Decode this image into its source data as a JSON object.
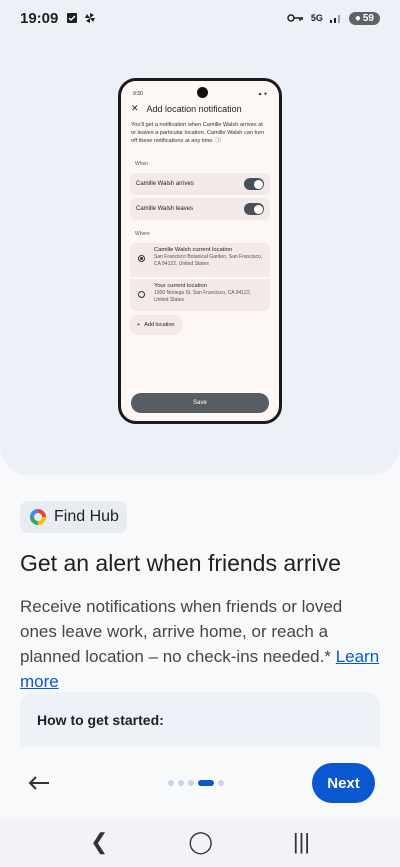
{
  "status_bar": {
    "time": "19:09",
    "network": "5G",
    "battery": "59"
  },
  "mockup": {
    "status_time": "9:30",
    "header_title": "Add location notification",
    "intro": "You'll get a notification when Camille Walsh arrives at or leaves a particular location. Camille Walsh can turn off these notifications at any time.",
    "when_label": "When",
    "toggles": [
      {
        "label": "Camille Walsh arrives",
        "on": true
      },
      {
        "label": "Camille Walsh leaves",
        "on": true
      }
    ],
    "where_label": "Where",
    "locations": [
      {
        "title": "Camille Walsh current location",
        "address": "San Francisco Botanical Garden, San Francisco, CA 94122, United States",
        "selected": true
      },
      {
        "title": "Your current location",
        "address": "1300 Noriega St, San Francisco, CA 94122, United States",
        "selected": false
      }
    ],
    "add_location": "Add location",
    "save": "Save"
  },
  "chip": {
    "label": "Find Hub"
  },
  "title": "Get an alert when friends arrive",
  "description": "Receive notifications when friends or loved ones leave work, arrive home, or reach a planned location – no check-ins needed.*",
  "learn_more": "Learn more",
  "how_to": "How to get started:",
  "pager": {
    "total": 5,
    "current": 4
  },
  "next_label": "Next",
  "colors": {
    "accent": "#0b57d0",
    "hero_bg": "#edf0f6"
  }
}
